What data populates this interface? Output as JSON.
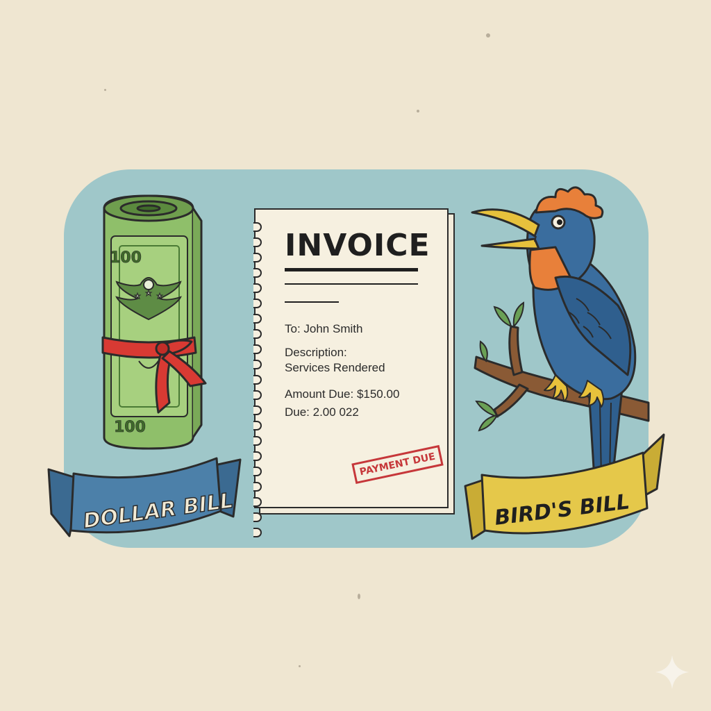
{
  "invoice": {
    "title": "INVOICE",
    "to": "To: John Smith",
    "description_label": "Description:",
    "description_value": "Services Rendered",
    "amount_due": "Amount Due: $150.00",
    "due": "Due: 2.00 022",
    "stamp": "PAYMENT DUE"
  },
  "left": {
    "banner": "DOLLAR BILL",
    "note_top": "100",
    "note_bottom": "100"
  },
  "right": {
    "banner": "BIRD'S BILL"
  },
  "colors": {
    "background": "#efe6d1",
    "panel": "#9fc7c9",
    "money_green": "#8fbf6a",
    "ribbon_red": "#d83a33",
    "ribbon_blue": "#4c80a9",
    "ribbon_yellow": "#e5c84a",
    "bird_blue": "#3a6d9e",
    "bird_orange": "#e8803a",
    "stamp_red": "#c6373a"
  }
}
